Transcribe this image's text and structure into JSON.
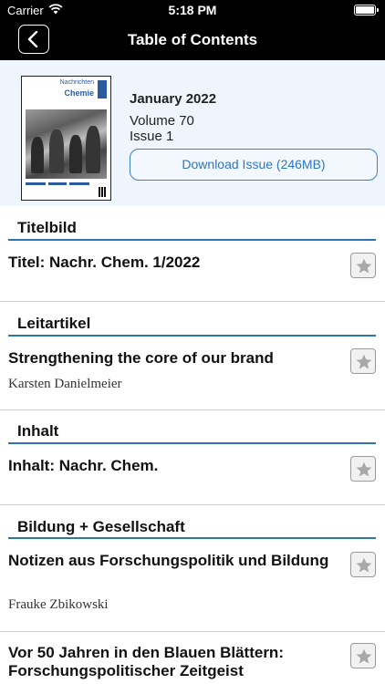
{
  "status_bar": {
    "carrier": "Carrier",
    "time": "5:18 PM"
  },
  "nav": {
    "title": "Table of Contents",
    "back_icon": "chevron-left-icon"
  },
  "issue": {
    "cover_masthead_line1": "Nachrichten",
    "cover_masthead_line2": "Chemie",
    "date": "January 2022",
    "volume": "Volume 70",
    "issue": "Issue 1",
    "download_label": "Download Issue (246MB)"
  },
  "sections": [
    {
      "label": "Titelbild",
      "articles": [
        {
          "title": "Titel: Nachr. Chem. 1/2022",
          "author": ""
        }
      ]
    },
    {
      "label": "Leitartikel",
      "articles": [
        {
          "title": "Strengthening the core of our brand",
          "author": "Karsten Danielmeier"
        }
      ]
    },
    {
      "label": "Inhalt",
      "articles": [
        {
          "title": "Inhalt: Nachr. Chem.",
          "author": ""
        }
      ]
    },
    {
      "label": "Bildung + Gesellschaft",
      "articles": [
        {
          "title": "Notizen aus Forschungspolitik und Bildung",
          "author": "Frauke Zbikowski"
        },
        {
          "title": "Vor 50 Jahren in den Blauen Blättern: Forschungspolitischer Zeitgeist",
          "author": ""
        }
      ]
    }
  ],
  "colors": {
    "accent": "#2e74b5",
    "link": "#2f75c2",
    "header_bg": "#eef5fc"
  },
  "icons": {
    "favorite": "star-icon"
  }
}
